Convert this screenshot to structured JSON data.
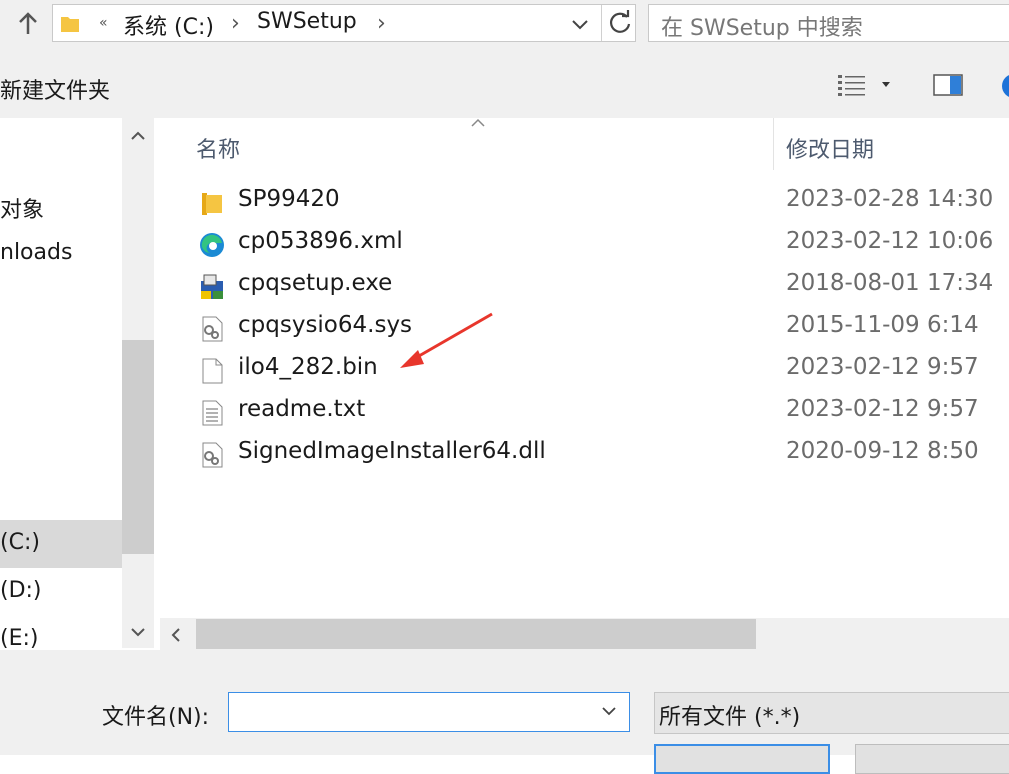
{
  "address": {
    "overflow_glyph": "«",
    "crumbs": [
      "系统 (C:)",
      "SWSetup"
    ],
    "separator": "›"
  },
  "search": {
    "placeholder": "在 SWSetup 中搜索"
  },
  "toolbar": {
    "new_folder": "新建文件夹"
  },
  "nav": {
    "items": [
      "对象",
      "nloads",
      "(C:)",
      "(D:)",
      "(E:)"
    ],
    "selected_index": 2
  },
  "columns": {
    "name": "名称",
    "modified": "修改日期"
  },
  "files": [
    {
      "name": "SP99420",
      "date": "2023-02-28 14:30",
      "icon": "folder-icon"
    },
    {
      "name": "cp053896.xml",
      "date": "2023-02-12 10:06",
      "icon": "edge-icon"
    },
    {
      "name": "cpqsetup.exe",
      "date": "2018-08-01 17:34",
      "icon": "installer-icon"
    },
    {
      "name": "cpqsysio64.sys",
      "date": "2015-11-09 6:14",
      "icon": "system-file-icon"
    },
    {
      "name": "ilo4_282.bin",
      "date": "2023-02-12 9:57",
      "icon": "blank-file-icon"
    },
    {
      "name": "readme.txt",
      "date": "2023-02-12 9:57",
      "icon": "text-file-icon"
    },
    {
      "name": "SignedImageInstaller64.dll",
      "date": "2020-09-12 8:50",
      "icon": "system-file-icon"
    }
  ],
  "footer": {
    "filename_label": "文件名(N):",
    "filename_value": "",
    "filetype": "所有文件 (*.*)"
  },
  "annotation": {
    "arrow_color": "#e8362c",
    "points_to": "ilo4_282.bin"
  },
  "colors": {
    "accent": "#3b8ee6",
    "folder": "#f5c542"
  }
}
